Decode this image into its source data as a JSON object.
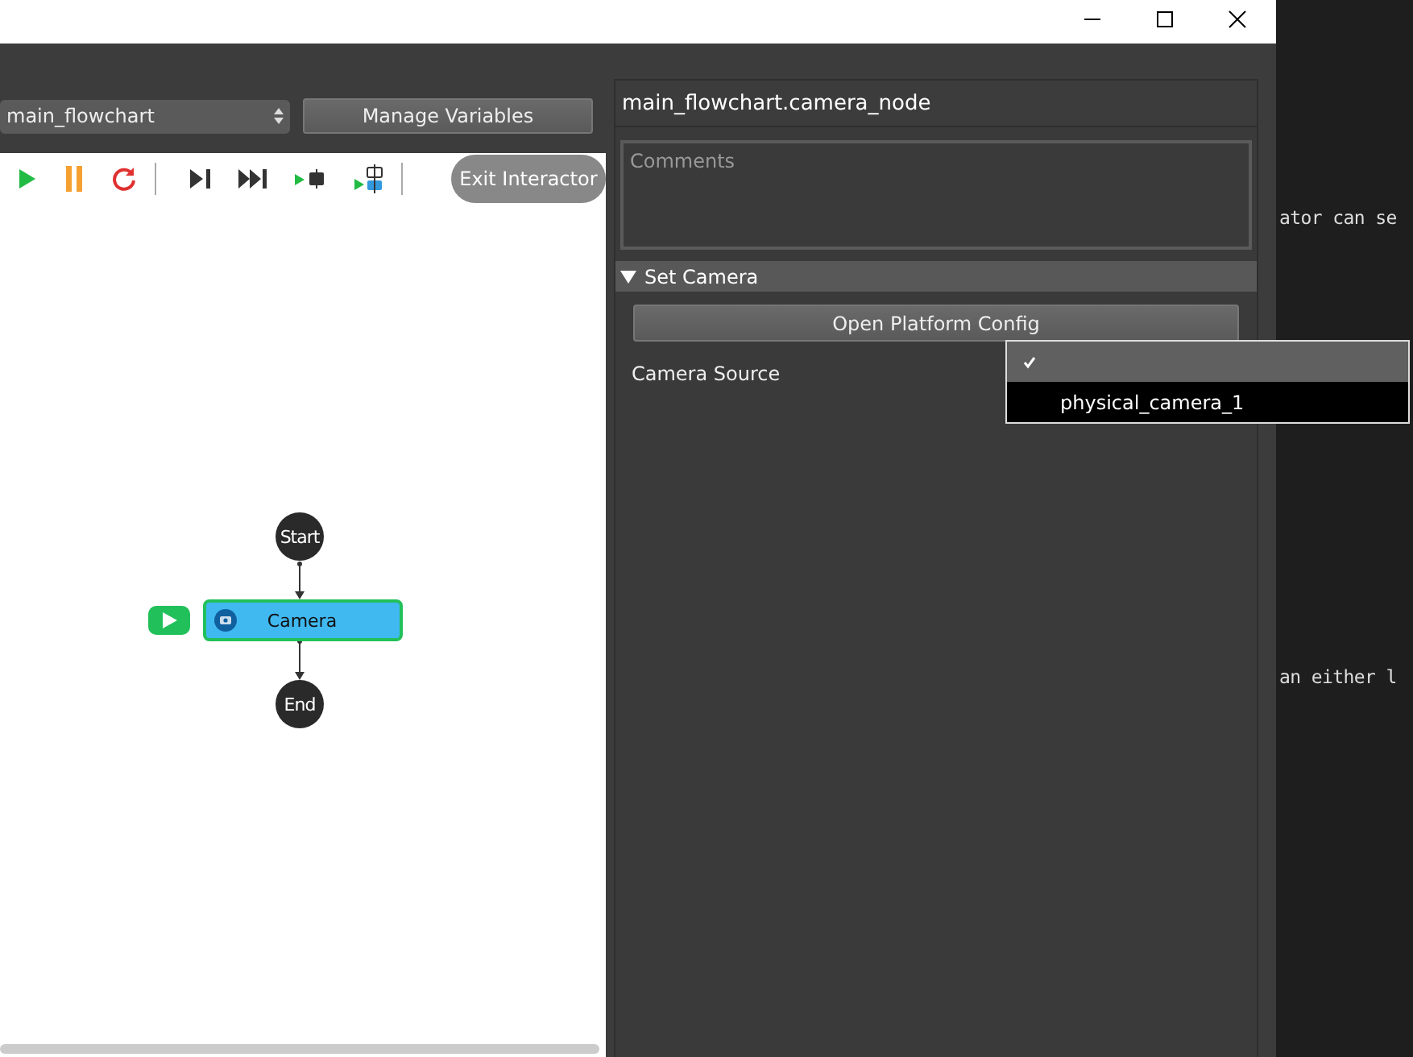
{
  "flowchart_selector": {
    "value": "main_flowchart"
  },
  "manage_button": "Manage Variables",
  "toolbar": [
    {
      "kind": "run"
    },
    {
      "kind": "pause"
    },
    {
      "kind": "restart"
    },
    {
      "kind": "separator"
    },
    {
      "kind": "step"
    },
    {
      "kind": "fast-forward"
    },
    {
      "kind": "step-over"
    },
    {
      "kind": "step-into"
    },
    {
      "kind": "separator"
    }
  ],
  "exit_button": "Exit Interactor",
  "nodes": [
    {
      "kind": "terminal",
      "label": "Start"
    },
    {
      "kind": "action",
      "label": "Camera",
      "selected": true,
      "running": true
    },
    {
      "kind": "terminal",
      "label": "End"
    }
  ],
  "properties": {
    "title": "main_flowchart.camera_node",
    "comments_placeholder": "Comments",
    "section": {
      "title": "Set Camera",
      "expanded": true
    },
    "config_button": "Open Platform Config",
    "field_label": "Camera Source",
    "options": [
      {
        "selected": true
      },
      {
        "label": "physical_camera_1",
        "selected": false
      }
    ]
  },
  "editor_lines": [
    "ator can se",
    "an either l"
  ]
}
